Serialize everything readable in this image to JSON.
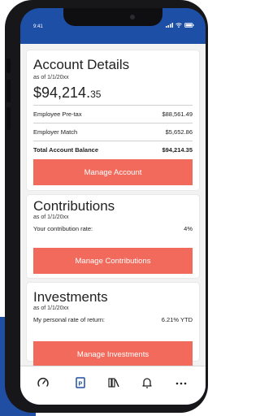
{
  "status": {
    "time": "9:41"
  },
  "account": {
    "title": "Account Details",
    "as_of": "as of 1/1/20xx",
    "total_dollars": "$94,214.",
    "total_cents": "35",
    "rows": [
      {
        "label": "Employee Pre-tax",
        "value": "$88,561.49"
      },
      {
        "label": "Employer Match",
        "value": "$5,652.86"
      },
      {
        "label": "Total Account Balance",
        "value": "$94,214.35"
      }
    ],
    "button": "Manage Account"
  },
  "contributions": {
    "title": "Contributions",
    "as_of": "as of 1/1/20xx",
    "row_label": "Your contribution rate:",
    "row_value": "4%",
    "button": "Manage Contributions"
  },
  "investments": {
    "title": "Investments",
    "as_of": "as of 1/1/20xx",
    "row_label": "My personal rate of return:",
    "row_value": "6.21% YTD",
    "button": "Manage Investments"
  },
  "tabbar": {
    "icons": [
      "gauge-icon",
      "document-icon",
      "library-icon",
      "bell-icon",
      "more-icon"
    ],
    "active_color": "#1e4fa6"
  },
  "colors": {
    "brand": "#1e4fa6",
    "accent_button": "#f16a5c",
    "phone": "#17171a"
  }
}
